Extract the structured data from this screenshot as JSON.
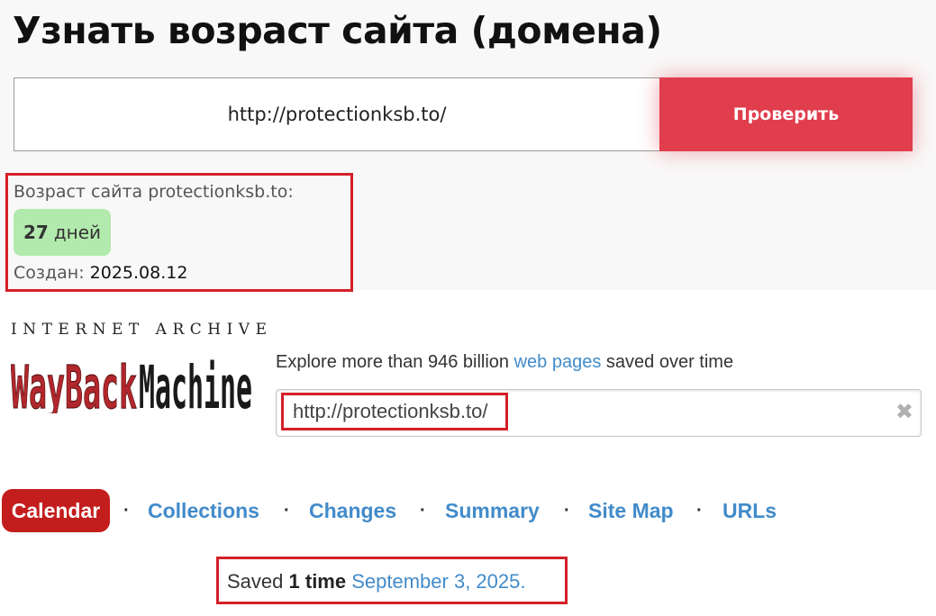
{
  "age_checker": {
    "title": "Узнать возраст сайта (домена)",
    "input_value": "http://protectionksb.to/",
    "button_label": "Проверить",
    "accent_color": "#e03d4d",
    "result": {
      "label": "Возраст сайта protectionksb.to:",
      "age_number": "27",
      "age_unit": "дней",
      "badge_color": "#b2eaad",
      "created_label": "Создан:",
      "created_date": "2025.08.12"
    }
  },
  "wayback": {
    "logo_top": "INTERNET ARCHIVE",
    "logo_word1": "WayBack",
    "logo_word2": "Machine",
    "explore_prefix": "Explore more than 946 billion",
    "explore_link": "web pages",
    "explore_suffix": "saved over time",
    "search_value": "http://protectionksb.to/",
    "clear_icon": "✖",
    "nav": {
      "calendar": "Calendar",
      "collections": "Collections",
      "changes": "Changes",
      "summary": "Summary",
      "site_map": "Site Map",
      "urls": "URLs",
      "separator": "·"
    },
    "saved": {
      "prefix": "Saved",
      "count": "1 time",
      "date": "September 3, 2025."
    },
    "link_color": "#428bca",
    "calendar_color": "#c41d1d"
  },
  "highlight_color": "#d42027"
}
